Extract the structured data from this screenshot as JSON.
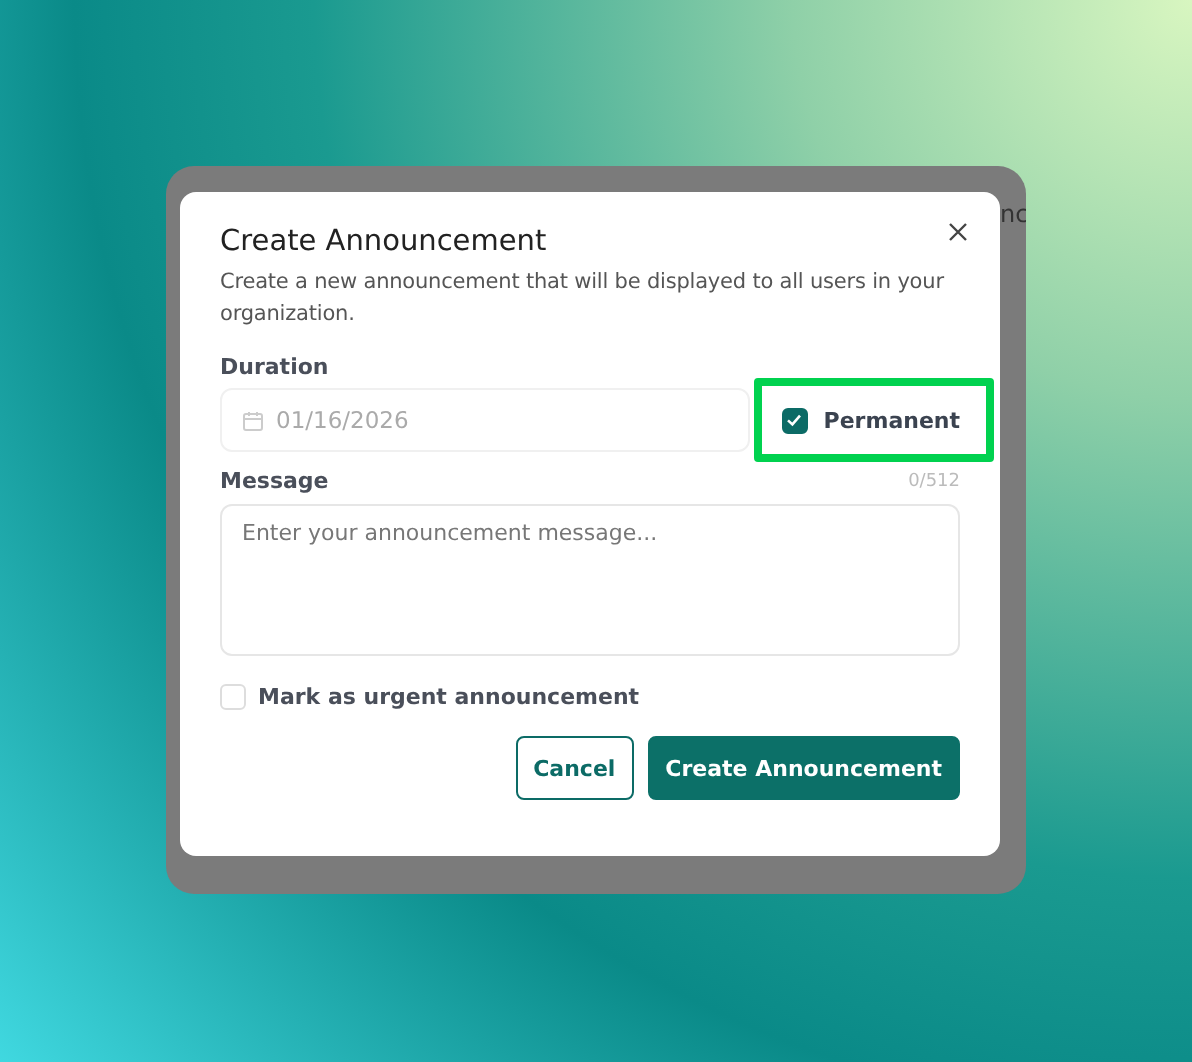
{
  "background_window": {
    "title_fragment": "nc"
  },
  "dialog": {
    "title": "Create Announcement",
    "description": "Create a new announcement that will be displayed to all users in your organization.",
    "duration": {
      "label": "Duration",
      "date": "01/16/2026",
      "disabled": true,
      "permanent": {
        "label": "Permanent",
        "checked": true,
        "highlighted": true
      }
    },
    "message": {
      "label": "Message",
      "counter": "0/512",
      "placeholder": "Enter your announcement message..."
    },
    "urgent": {
      "label": "Mark as urgent announcement",
      "checked": false
    },
    "buttons": [
      {
        "label": "Cancel",
        "kind": "secondary"
      },
      {
        "label": "Create Announcement",
        "kind": "primary"
      }
    ]
  }
}
